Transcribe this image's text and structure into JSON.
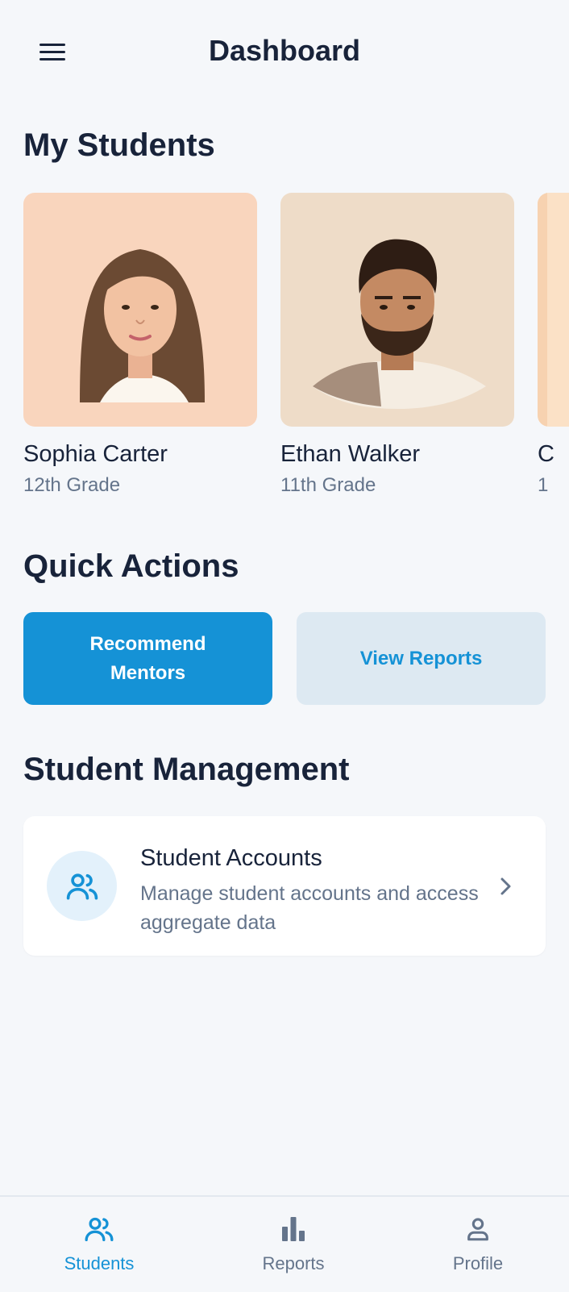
{
  "header": {
    "title": "Dashboard",
    "menu_icon": "hamburger-menu-icon"
  },
  "students_section": {
    "title": "My Students",
    "students": [
      {
        "name": "Sophia Carter",
        "grade": "12th Grade",
        "avatar_bg": "#f9d5bd"
      },
      {
        "name": "Ethan Walker",
        "grade": "11th Grade",
        "avatar_bg": "#eedcc8"
      },
      {
        "name": "C",
        "grade": "1",
        "avatar_bg": "#fbe1c6"
      }
    ]
  },
  "quick_actions": {
    "title": "Quick Actions",
    "recommend_label_line1": "Recommend",
    "recommend_label_line2": "Mentors",
    "view_reports_label": "View Reports"
  },
  "management": {
    "title": "Student Management",
    "card_title": "Student Accounts",
    "card_desc": "Manage student accounts and access aggregate data",
    "icon": "users-icon"
  },
  "bottom_nav": [
    {
      "label": "Students",
      "icon": "users-icon",
      "active": true
    },
    {
      "label": "Reports",
      "icon": "bar-chart-icon",
      "active": false
    },
    {
      "label": "Profile",
      "icon": "user-icon",
      "active": false
    }
  ],
  "colors": {
    "accent": "#1592d6",
    "text": "#18233a",
    "muted": "#64748b",
    "background": "#f5f7fa"
  }
}
